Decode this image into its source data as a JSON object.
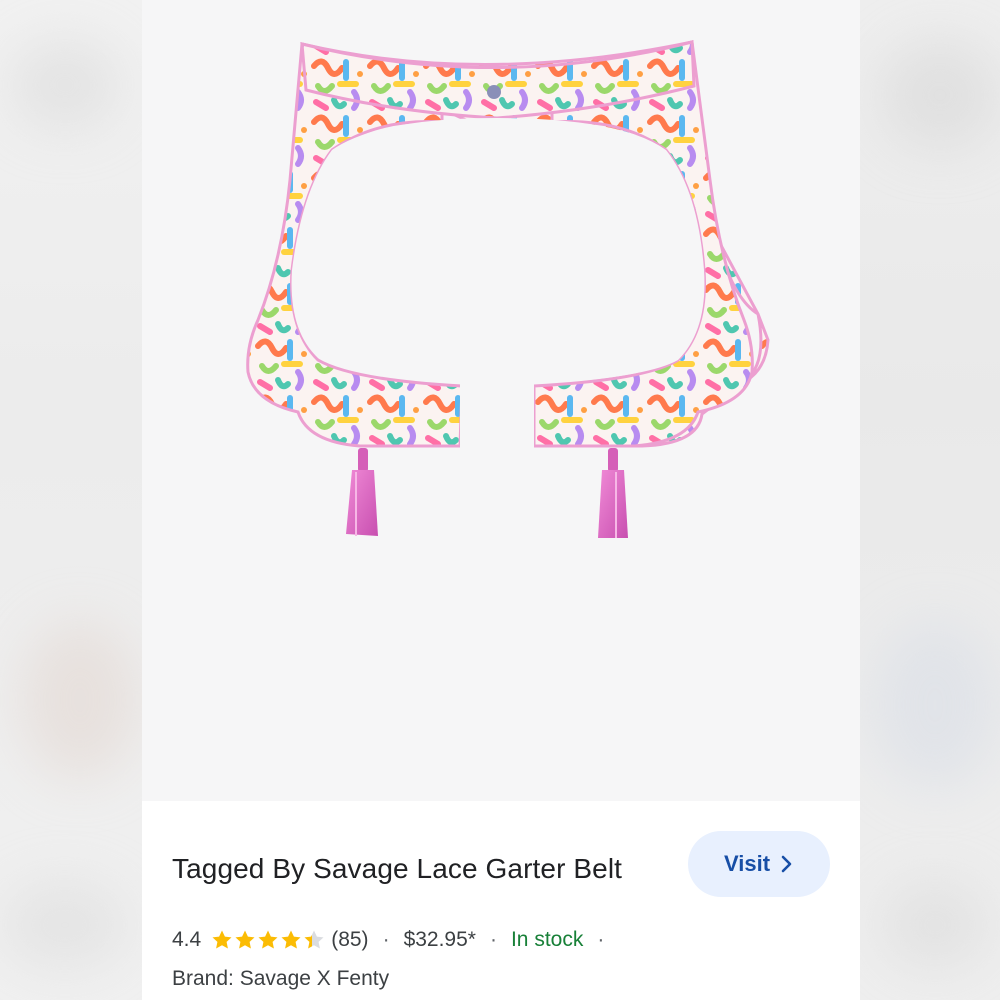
{
  "product": {
    "title": "Tagged By Savage Lace Garter Belt",
    "rating": "4.4",
    "rating_value": 4.4,
    "rating_max": 5,
    "review_count": "(85)",
    "price": "$32.95*",
    "stock_status": "In stock",
    "brand_line": "Brand: Savage X Fenty",
    "separator": "·"
  },
  "actions": {
    "visit_label": "Visit",
    "visit_icon": "chevron-right-icon"
  },
  "colors": {
    "star_filled": "#fbbc04",
    "star_empty": "#dadce0",
    "stock_green": "#188038",
    "visit_bg": "#e8f0fe",
    "visit_text": "#174ea6",
    "strap_pink": "#e070c8"
  }
}
